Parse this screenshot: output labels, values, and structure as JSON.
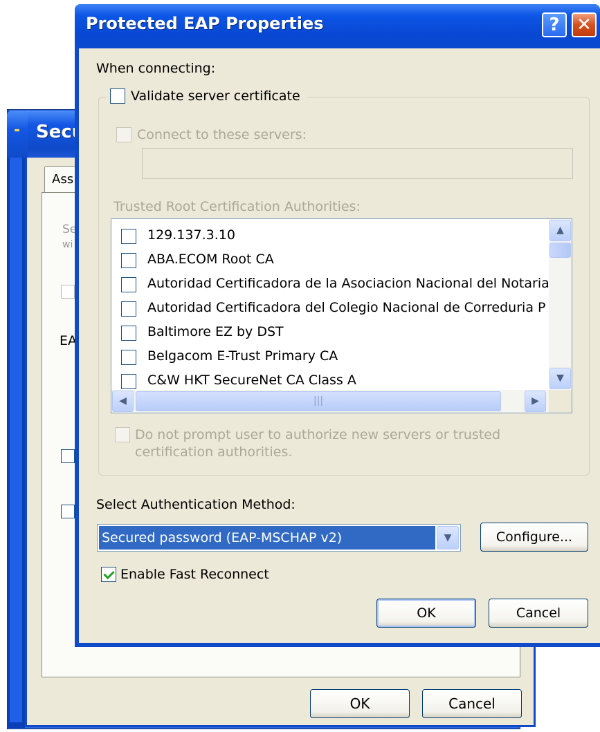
{
  "background_window": {
    "title": "Secu",
    "tab_label": "Ass",
    "fragments": [
      "Se",
      "wi",
      "EA"
    ],
    "ok_label": "OK",
    "cancel_label": "Cancel"
  },
  "dialog": {
    "title": "Protected EAP Properties",
    "help_glyph": "?",
    "close_glyph": "✕",
    "when_connecting_label": "When connecting:",
    "validate_cert": {
      "label": "Validate server certificate",
      "checked": false
    },
    "connect_servers": {
      "label": "Connect to these servers:",
      "checked": false,
      "value": ""
    },
    "trusted_root_label": "Trusted Root Certification Authorities:",
    "ca_list": [
      "129.137.3.10",
      "ABA.ECOM Root CA",
      "Autoridad Certificadora de la Asociacion Nacional del Notaria",
      "Autoridad Certificadora del Colegio Nacional de Correduria P",
      "Baltimore EZ by DST",
      "Belgacom E-Trust Primary CA",
      "C&W HKT SecureNet CA Class A"
    ],
    "do_not_prompt": {
      "label_line1": "Do not prompt user to authorize new servers or trusted",
      "label_line2": "certification authorities.",
      "checked": false
    },
    "auth_method_label": "Select Authentication Method:",
    "auth_method_value": "Secured password (EAP-MSCHAP v2)",
    "configure_label": "Configure...",
    "fast_reconnect": {
      "label": "Enable Fast Reconnect",
      "checked": true
    },
    "ok_label": "OK",
    "cancel_label": "Cancel"
  },
  "icons": {
    "scroll_up": "▲",
    "scroll_down": "▼",
    "scroll_left": "◀",
    "scroll_right": "▶",
    "dropdown": "▼",
    "grip": "|||"
  },
  "colors": {
    "titlebar": "#0a4bd0",
    "dialog_bg": "#ece9d8",
    "selection": "#316ac5",
    "check_green": "#21a121"
  }
}
